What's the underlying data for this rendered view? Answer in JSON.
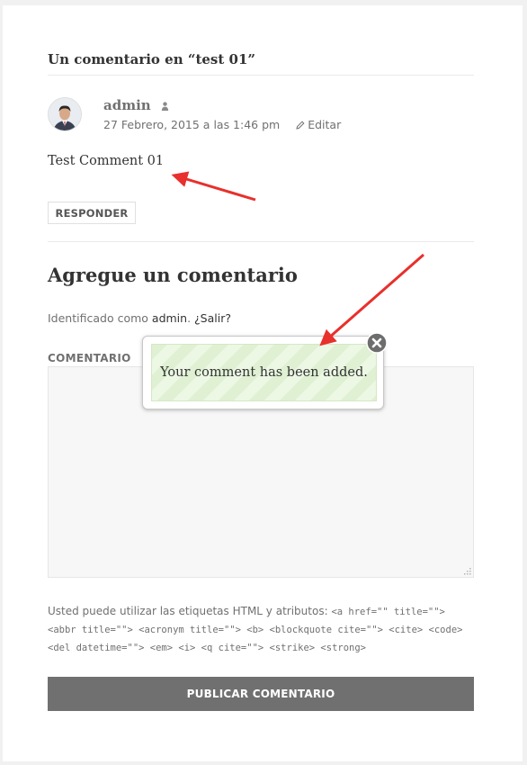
{
  "comments": {
    "title": "Un comentario en “test 01”",
    "items": [
      {
        "author": "admin",
        "date": "27 Febrero, 2015 a las 1:46 pm",
        "edit_label": "Editar",
        "text": "Test Comment 01",
        "reply_label": "RESPONDER"
      }
    ]
  },
  "form": {
    "title": "Agregue un comentario",
    "logged_prefix": "Identificado como",
    "logged_user": "admin",
    "logged_sep": ".",
    "logout_label": "¿Salir?",
    "comment_label": "COMENTARIO",
    "allowed_prefix": "Usted puede utilizar las etiquetas HTML y atributos:",
    "allowed_tags": "<a href=\"\" title=\"\"> <abbr title=\"\"> <acronym title=\"\"> <b> <blockquote cite=\"\"> <cite> <code> <del datetime=\"\"> <em> <i> <q cite=\"\"> <strike> <strong>",
    "submit_label": "PUBLICAR COMENTARIO"
  },
  "notice": {
    "message": "Your comment has been added."
  },
  "colors": {
    "annotation_arrow": "#e8302c",
    "submit_bg": "#707070",
    "notice_green": "#dff0d3"
  }
}
